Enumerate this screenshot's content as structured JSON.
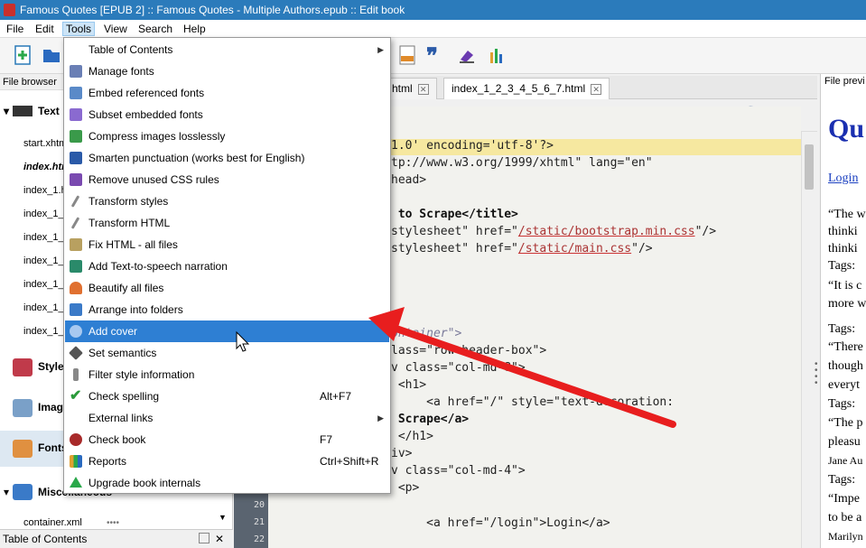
{
  "window": {
    "title": "Famous Quotes [EPUB 2] :: Famous Quotes - Multiple Authors.epub :: Edit book"
  },
  "menubar": {
    "items": [
      "File",
      "Edit",
      "Tools",
      "View",
      "Search",
      "Help"
    ],
    "active": "Tools"
  },
  "left_panel": {
    "header": "File browser",
    "text_group": "Text",
    "files": [
      "start.xhtml",
      "index.html",
      "index_1.html",
      "index_1_",
      "index_1_",
      "index_1_",
      "index_1_",
      "index_1_",
      "index_1_"
    ],
    "categories": [
      "Styles",
      "Images",
      "Fonts",
      "Miscellaneous"
    ],
    "misc_file": "container.xml",
    "bottom_panel_title": "Table of Contents"
  },
  "editor": {
    "tabs": [
      {
        "label": "html"
      },
      {
        "label": "index_1_2_3_4_5_6_7.html"
      }
    ],
    "line_numbers": [
      "20",
      "21",
      "22"
    ],
    "code_lines": [
      {
        "pre": "1.0' encoding='utf-8'?>",
        "val": ""
      },
      {
        "pre": "tp://www.w3.org/1999/xhtml\" lang=\"en\"",
        "val": ""
      },
      {
        "pre": "head>",
        "val": ""
      },
      {
        "pre": " to Scrape</title>",
        "val": ""
      },
      {
        "pre": "stylesheet\" href=\"",
        "val": "/static/bootstrap.min.css",
        "post": "\"/>"
      },
      {
        "pre": "stylesheet\" href=\"",
        "val": "/static/main.css",
        "post": "\"/>"
      },
      {
        "pre": "ontainer\">",
        "val": ""
      },
      {
        "pre": "lass=\"row header-box\">",
        "val": ""
      },
      {
        "pre": "v class=\"col-md-8\">",
        "val": ""
      },
      {
        "pre": " <h1>",
        "val": ""
      },
      {
        "pre": "     <a href=\"/\" style=\"text-decoration:",
        "val": ""
      },
      {
        "pre": " Scrape</a>",
        "val": ""
      },
      {
        "pre": " </h1>",
        "val": ""
      },
      {
        "pre": "iv>",
        "val": ""
      },
      {
        "pre": "v class=\"col-md-4\">",
        "val": ""
      },
      {
        "pre": " <p>",
        "val": ""
      },
      {
        "pre": "     <a href=\"/login\">Login</a>",
        "val": ""
      }
    ]
  },
  "preview": {
    "header": "File previ",
    "lines": [
      "Qu",
      "Login",
      "“The w",
      "thinki",
      "thinki",
      "Tags:",
      "“It is c",
      "more w",
      "Tags:",
      "“There",
      "though",
      "everyt",
      "Tags:",
      "“The p",
      "pleasu",
      "Jane Au",
      "Tags:",
      "“Impe",
      "to be a",
      "Marilyn"
    ]
  },
  "tools_menu": {
    "items": [
      {
        "label": "Table of Contents",
        "shortcut": "",
        "submenu": true,
        "icon": "none",
        "color": "#ffffff"
      },
      {
        "label": "Manage fonts",
        "shortcut": "",
        "submenu": false,
        "icon": "font-icon",
        "color": "#6a7fb5"
      },
      {
        "label": "Embed referenced fonts",
        "shortcut": "",
        "submenu": false,
        "icon": "embed-font-icon",
        "color": "#5a8ac8"
      },
      {
        "label": "Subset embedded fonts",
        "shortcut": "",
        "submenu": false,
        "icon": "subset-font-icon",
        "color": "#8a6ad0"
      },
      {
        "label": "Compress images losslessly",
        "shortcut": "",
        "submenu": false,
        "icon": "compress-icon",
        "color": "#3a9a4a"
      },
      {
        "label": "Smarten punctuation (works best for English)",
        "shortcut": "",
        "submenu": false,
        "icon": "quote-icon",
        "color": "#2a5aa8"
      },
      {
        "label": "Remove unused CSS rules",
        "shortcut": "",
        "submenu": false,
        "icon": "eraser-icon",
        "color": "#7a4ab0"
      },
      {
        "label": "Transform styles",
        "shortcut": "",
        "submenu": false,
        "icon": "wand-icon",
        "color": "#888888"
      },
      {
        "label": "Transform HTML",
        "shortcut": "",
        "submenu": false,
        "icon": "wand-icon",
        "color": "#888888"
      },
      {
        "label": "Fix HTML - all files",
        "shortcut": "",
        "submenu": false,
        "icon": "fix-html-icon",
        "color": "#b8a060"
      },
      {
        "label": "Add Text-to-speech narration",
        "shortcut": "",
        "submenu": false,
        "icon": "megaphone-icon",
        "color": "#2a8a6a"
      },
      {
        "label": "Beautify all files",
        "shortcut": "",
        "submenu": false,
        "icon": "flower-icon",
        "color": "#e07030"
      },
      {
        "label": "Arrange into folders",
        "shortcut": "",
        "submenu": false,
        "icon": "folder-icon",
        "color": "#3a7ac8"
      },
      {
        "label": "Add cover",
        "shortcut": "",
        "submenu": false,
        "icon": "cover-icon",
        "color": "#7aa8e0"
      },
      {
        "label": "Set semantics",
        "shortcut": "",
        "submenu": false,
        "icon": "tag-icon",
        "color": "#555555"
      },
      {
        "label": "Filter style information",
        "shortcut": "",
        "submenu": false,
        "icon": "filter-icon",
        "color": "#888888"
      },
      {
        "label": "Check spelling",
        "shortcut": "Alt+F7",
        "submenu": false,
        "icon": "spellcheck-icon",
        "color": "#2a9a3a"
      },
      {
        "label": "External links",
        "shortcut": "",
        "submenu": true,
        "icon": "none",
        "color": "#ffffff"
      },
      {
        "label": "Check book",
        "shortcut": "F7",
        "submenu": false,
        "icon": "bug-icon",
        "color": "#a82a2a"
      },
      {
        "label": "Reports",
        "shortcut": "Ctrl+Shift+R",
        "submenu": false,
        "icon": "reports-icon",
        "color": "#d0a030"
      },
      {
        "label": "Upgrade book internals",
        "shortcut": "",
        "submenu": false,
        "icon": "upgrade-icon",
        "color": "#2aa84a"
      }
    ],
    "highlighted": "Add cover",
    "accent": "#2e7fd3"
  },
  "annotation": {
    "color": "#e81e1e"
  }
}
